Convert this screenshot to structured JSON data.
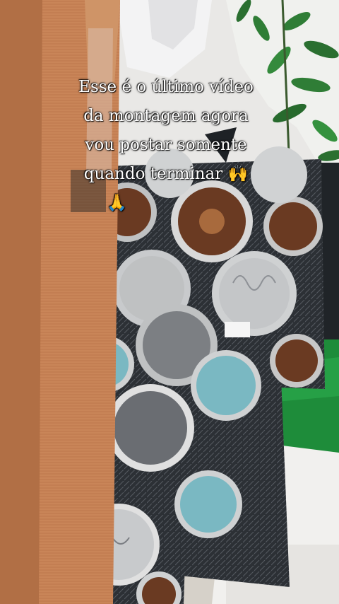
{
  "caption": {
    "lines": [
      "Esse é o último vídeo",
      "da montagem agora",
      "vou postar somente",
      "quando terminar 🙌",
      "🙏"
    ]
  },
  "colors": {
    "wood": "#c98558",
    "pillow_bg": "#2d3136",
    "circle_brown": "#6a3a22",
    "circle_teal": "#7ab8c2",
    "circle_grey": "#bfc1c2",
    "green_fabric": "#1e8c3a",
    "white_fabric": "#f1f0ee",
    "plant": "#2f7d36"
  }
}
